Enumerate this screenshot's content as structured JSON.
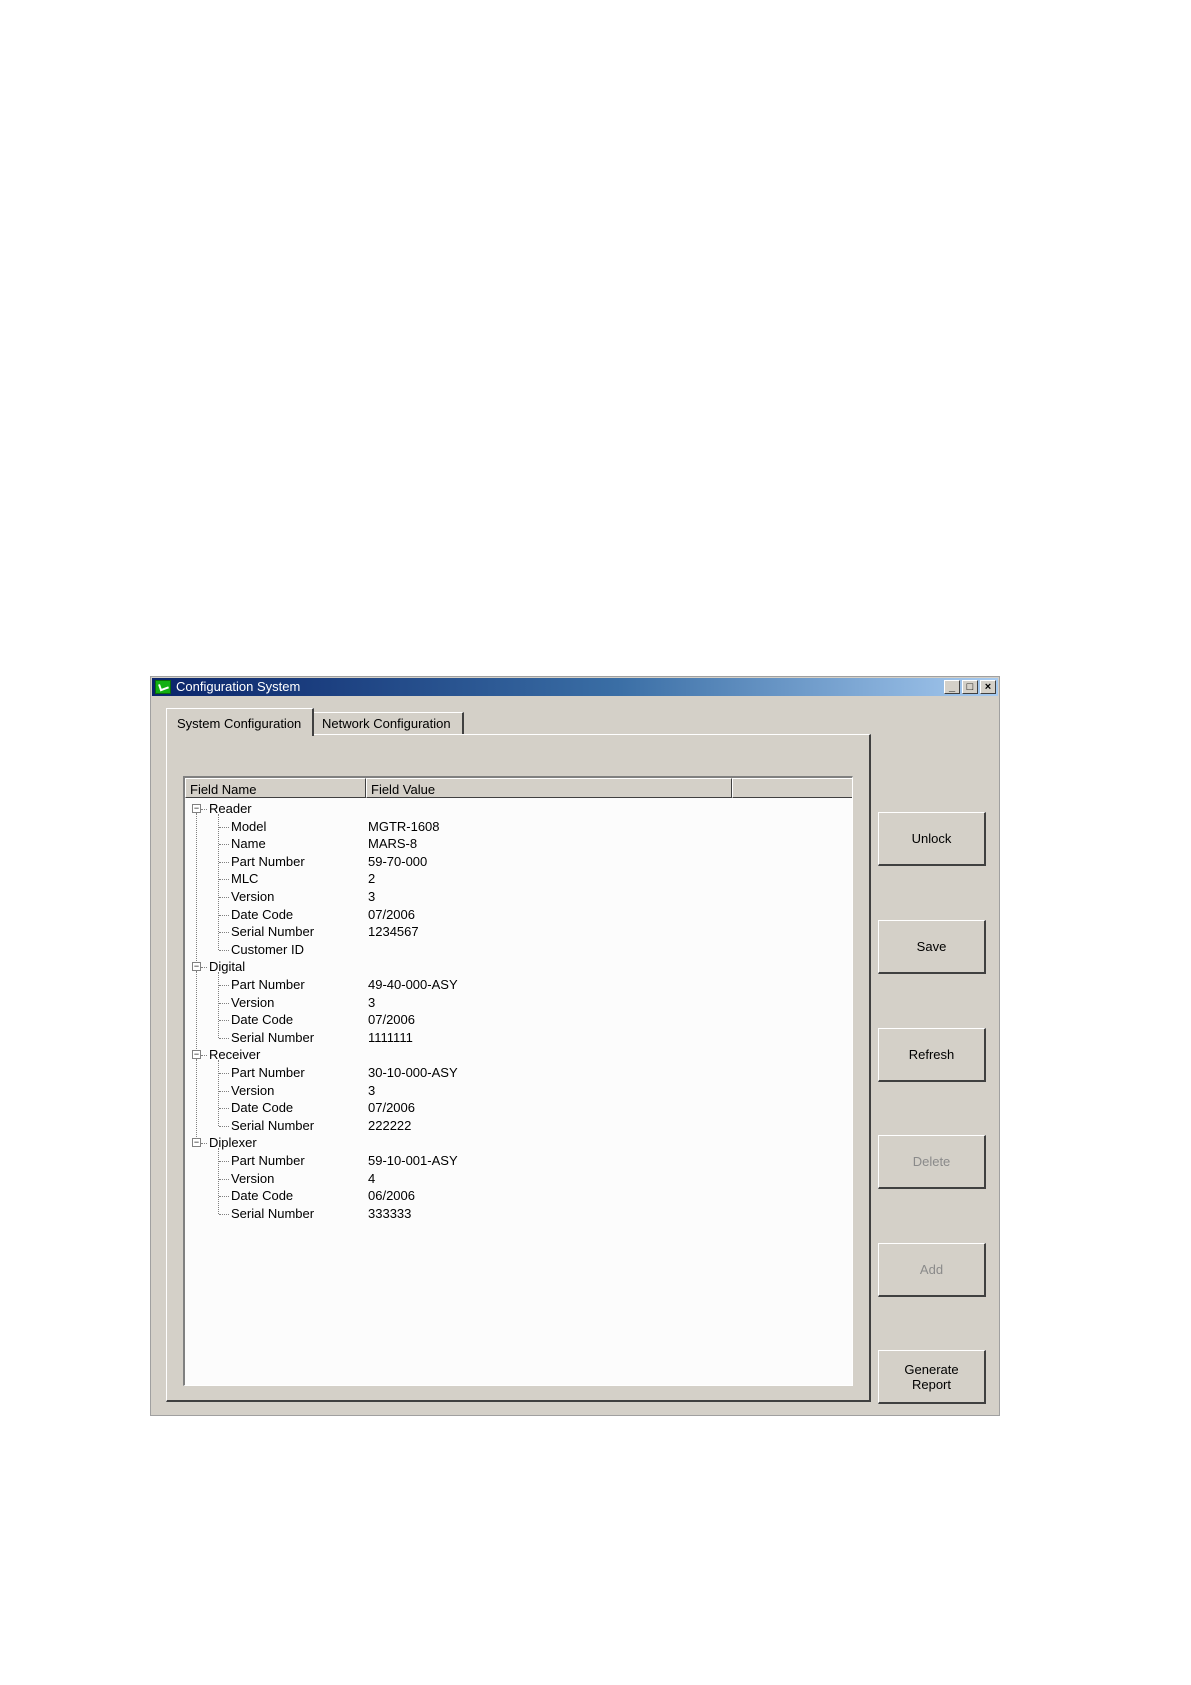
{
  "window": {
    "title": "Configuration System",
    "controls": {
      "minimize": "_",
      "maximize": "□",
      "close": "×"
    }
  },
  "tabs": [
    {
      "label": "System Configuration",
      "active": true
    },
    {
      "label": "Network Configuration",
      "active": false
    }
  ],
  "table": {
    "columns": [
      "Field Name",
      "Field Value",
      ""
    ],
    "groups": [
      {
        "name": "Reader",
        "expander": "−",
        "fields": [
          {
            "name": "Model",
            "value": "MGTR-1608"
          },
          {
            "name": "Name",
            "value": "MARS-8"
          },
          {
            "name": "Part Number",
            "value": "59-70-000"
          },
          {
            "name": "MLC",
            "value": "2"
          },
          {
            "name": "Version",
            "value": "3"
          },
          {
            "name": "Date Code",
            "value": "07/2006"
          },
          {
            "name": "Serial Number",
            "value": "1234567"
          },
          {
            "name": "Customer ID",
            "value": ""
          }
        ]
      },
      {
        "name": "Digital",
        "expander": "−",
        "fields": [
          {
            "name": "Part Number",
            "value": "49-40-000-ASY"
          },
          {
            "name": "Version",
            "value": "3"
          },
          {
            "name": "Date Code",
            "value": "07/2006"
          },
          {
            "name": "Serial Number",
            "value": "1111111"
          }
        ]
      },
      {
        "name": "Receiver",
        "expander": "−",
        "fields": [
          {
            "name": "Part Number",
            "value": "30-10-000-ASY"
          },
          {
            "name": "Version",
            "value": "3"
          },
          {
            "name": "Date Code",
            "value": "07/2006"
          },
          {
            "name": "Serial Number",
            "value": "222222"
          }
        ]
      },
      {
        "name": "Diplexer",
        "expander": "−",
        "fields": [
          {
            "name": "Part Number",
            "value": "59-10-001-ASY"
          },
          {
            "name": "Version",
            "value": "4"
          },
          {
            "name": "Date Code",
            "value": "06/2006"
          },
          {
            "name": "Serial Number",
            "value": "333333"
          }
        ]
      }
    ]
  },
  "buttons": [
    {
      "key": "unlock",
      "label": "Unlock",
      "enabled": true
    },
    {
      "key": "save",
      "label": "Save",
      "enabled": true
    },
    {
      "key": "refresh",
      "label": "Refresh",
      "enabled": true
    },
    {
      "key": "delete",
      "label": "Delete",
      "enabled": false
    },
    {
      "key": "add",
      "label": "Add",
      "enabled": false
    },
    {
      "key": "generate-report",
      "label": "Generate\nReport",
      "enabled": true
    }
  ],
  "colors": {
    "titlebar_start": "#0a246a",
    "titlebar_end": "#a6caf0",
    "window_bg": "#d4d0c8",
    "disabled_text": "#8a8a8a"
  }
}
